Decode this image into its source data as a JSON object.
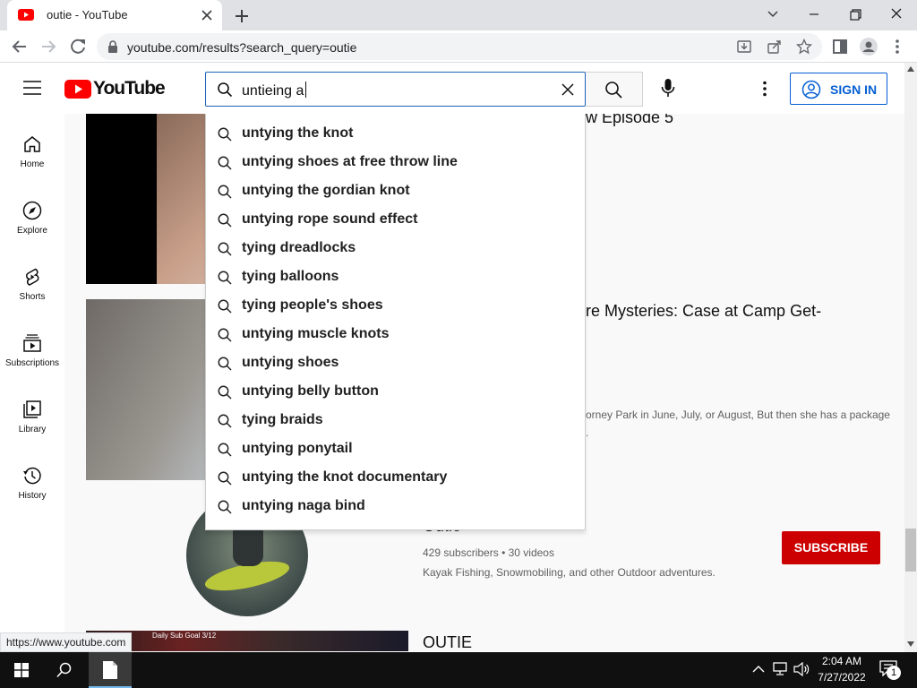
{
  "browser": {
    "tab_title": "outie - YouTube",
    "url": "youtube.com/results?search_query=outie",
    "status_url": "https://www.youtube.com"
  },
  "header": {
    "logo_text": "YouTube",
    "search_value": "untieing a",
    "signin_label": "SIGN IN"
  },
  "guide": {
    "items": [
      {
        "label": "Home",
        "icon": "home-icon"
      },
      {
        "label": "Explore",
        "icon": "compass-icon"
      },
      {
        "label": "Shorts",
        "icon": "shorts-icon"
      },
      {
        "label": "Subscriptions",
        "icon": "subscriptions-icon"
      },
      {
        "label": "Library",
        "icon": "library-icon"
      },
      {
        "label": "History",
        "icon": "history-icon"
      }
    ]
  },
  "suggestions": [
    "untying the knot",
    "untying shoes at free throw line",
    "untying the gordian knot",
    "untying rope sound effect",
    "tying dreadlocks",
    "tying balloons",
    "tying people's shoes",
    "untying muscle knots",
    "untying shoes",
    "untying belly button",
    "tying braids",
    "untying ponytail",
    "untying the knot documentary",
    "untying naga bind"
  ],
  "results": {
    "video1_title_fragment": "w Episode 5",
    "video2_title_fragment": "re Mysteries: Case at Camp Get-",
    "video2_desc_fragment": "orney Park in June, July, or August, But then she has a package",
    "video2_desc_fragment2": ".",
    "channel": {
      "name_fragment": "Outie",
      "subscribers": "429 subscribers",
      "separator": "•",
      "videos": "30 videos",
      "description": "Kayak Fishing, Snowmobiling, and other Outdoor adventures.",
      "subscribe_label": "SUBSCRIBE"
    },
    "video3_title": "OUTIE",
    "video3_thumb_overlay": "Daily Sub Goal 3/12"
  },
  "taskbar": {
    "time": "2:04 AM",
    "date": "7/27/2022",
    "notification_count": "1"
  },
  "colors": {
    "youtube_red": "#ff0000",
    "subscribe_red": "#cc0000",
    "signin_blue": "#065fd4",
    "focus_blue": "#1c62b9"
  }
}
